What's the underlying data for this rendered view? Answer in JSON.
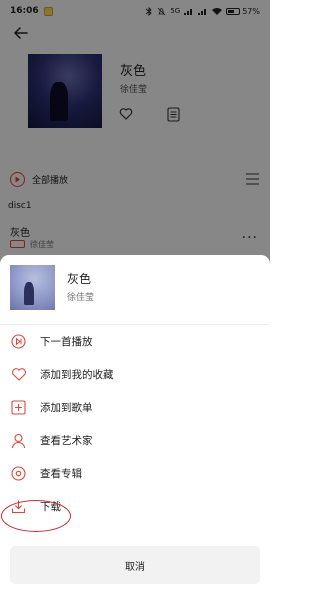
{
  "status_bar": {
    "time": "16:06",
    "network": "5G",
    "battery": "57%"
  },
  "album": {
    "title": "灰色",
    "artist": "徐佳莹"
  },
  "play_all": {
    "label": "全部播放"
  },
  "disc": {
    "label": "disc1"
  },
  "song": {
    "title": "灰色",
    "artist": "徐佳莹"
  },
  "sheet": {
    "song_title": "灰色",
    "song_artist": "徐佳莹",
    "menu": [
      {
        "label": "下一首播放",
        "icon": "play-next-icon"
      },
      {
        "label": "添加到我的收藏",
        "icon": "heart-icon"
      },
      {
        "label": "添加到歌单",
        "icon": "add-to-playlist-icon"
      },
      {
        "label": "查看艺术家",
        "icon": "artist-icon"
      },
      {
        "label": "查看专辑",
        "icon": "album-icon"
      },
      {
        "label": "下载",
        "icon": "download-icon"
      }
    ],
    "cancel_label": "取消"
  },
  "colors": {
    "accent": "#e0463a",
    "highlight_ring": "#d8262b",
    "overlay": "rgba(0,0,0,0.47)"
  }
}
